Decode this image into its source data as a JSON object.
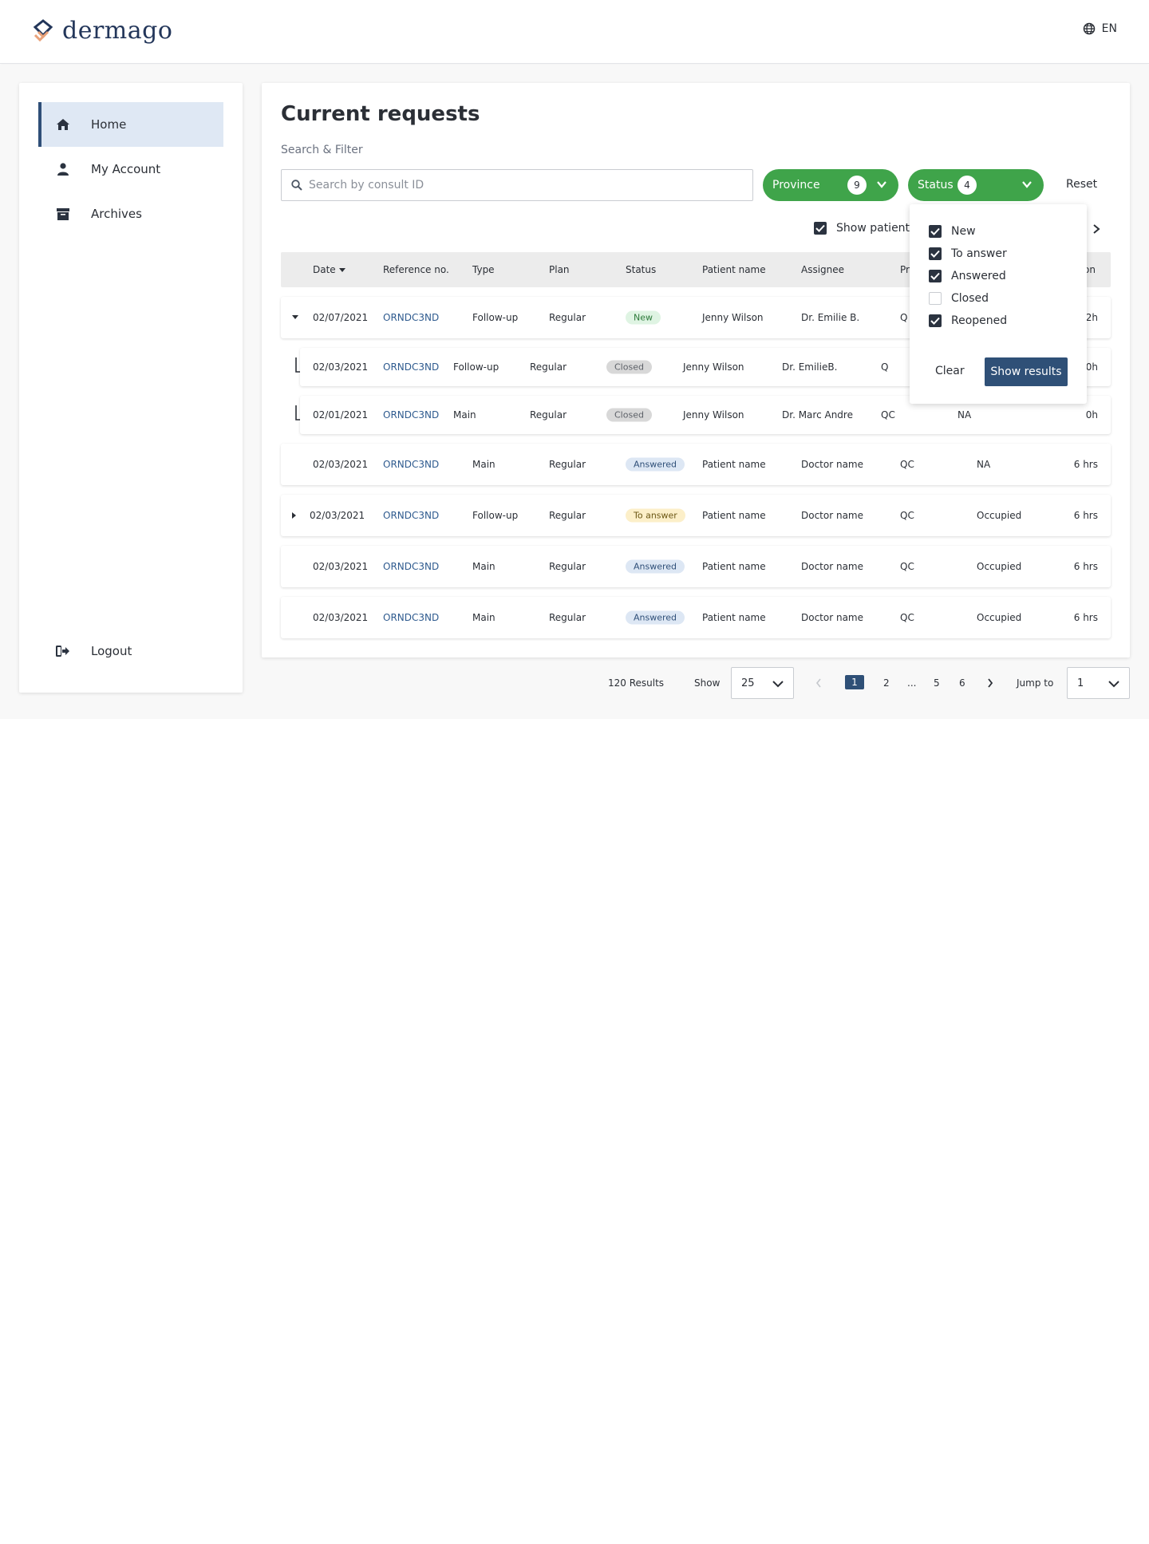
{
  "brand": {
    "name": "dermago"
  },
  "header": {
    "language": "EN"
  },
  "sidebar": {
    "items": [
      {
        "label": "Home",
        "icon": "home-icon",
        "active": true
      },
      {
        "label": "My Account",
        "icon": "user-icon"
      },
      {
        "label": "Archives",
        "icon": "archive-icon"
      }
    ],
    "logout": {
      "label": "Logout",
      "icon": "logout-icon"
    }
  },
  "main": {
    "title": "Current requests",
    "filter_label": "Search & Filter",
    "search": {
      "placeholder": "Search by consult ID",
      "value": ""
    },
    "province_filter": {
      "label": "Province",
      "count": "9"
    },
    "status_filter": {
      "label": "Status",
      "count": "4"
    },
    "reset_label": "Reset",
    "show_patients_label": "Show patients",
    "table": {
      "columns": [
        "Date",
        "Reference no.",
        "Type",
        "Plan",
        "Status",
        "Patient name",
        "Assignee",
        "Pr",
        "on"
      ],
      "rows": [
        {
          "date": "02/07/2021",
          "ref": "ORNDC3ND",
          "type": "Follow-up",
          "plan": "Regular",
          "status": "New",
          "patient": "Jenny Wilson",
          "assignee": "Dr. Emilie B.",
          "province": "Q",
          "availability": "",
          "time": "2h"
        },
        {
          "date": "02/03/2021",
          "ref": "ORNDC3ND",
          "type": "Follow-up",
          "plan": "Regular",
          "status": "Closed",
          "patient": "Jenny Wilson",
          "assignee": "Dr. EmilieB.",
          "province": "Q",
          "availability": "",
          "time": "0h"
        },
        {
          "date": "02/01/2021",
          "ref": "ORNDC3ND",
          "type": "Main",
          "plan": "Regular",
          "status": "Closed",
          "patient": "Jenny Wilson",
          "assignee": "Dr. Marc Andre",
          "province": "QC",
          "availability": "NA",
          "time": "0h"
        },
        {
          "date": "02/03/2021",
          "ref": "ORNDC3ND",
          "type": "Main",
          "plan": "Regular",
          "status": "Answered",
          "patient": "Patient name",
          "assignee": "Doctor name",
          "province": "QC",
          "availability": "NA",
          "time": "6 hrs"
        },
        {
          "date": "02/03/2021",
          "ref": "ORNDC3ND",
          "type": "Follow-up",
          "plan": "Regular",
          "status": "To answer",
          "patient": "Patient name",
          "assignee": "Doctor name",
          "province": "QC",
          "availability": "Occupied",
          "time": "6 hrs"
        },
        {
          "date": "02/03/2021",
          "ref": "ORNDC3ND",
          "type": "Main",
          "plan": "Regular",
          "status": "Answered",
          "patient": "Patient name",
          "assignee": "Doctor name",
          "province": "QC",
          "availability": "Occupied",
          "time": "6 hrs"
        },
        {
          "date": "02/03/2021",
          "ref": "ORNDC3ND",
          "type": "Main",
          "plan": "Regular",
          "status": "Answered",
          "patient": "Patient name",
          "assignee": "Doctor name",
          "province": "QC",
          "availability": "Occupied",
          "time": "6 hrs"
        }
      ]
    }
  },
  "status_dropdown": {
    "options": [
      {
        "label": "New",
        "checked": true
      },
      {
        "label": "To answer",
        "checked": true
      },
      {
        "label": "Answered",
        "checked": true
      },
      {
        "label": "Closed",
        "checked": false
      },
      {
        "label": "Reopened",
        "checked": true
      }
    ],
    "clear_label": "Clear",
    "show_results_label": "Show results"
  },
  "pagination": {
    "results": "120 Results",
    "show_label": "Show",
    "page_size": "25",
    "pages": [
      "1",
      "2",
      "...",
      "5",
      "6"
    ],
    "current_page": "1",
    "jump_label": "Jump to",
    "jump_value": "1"
  },
  "colors": {
    "primary": "#2f5077",
    "green": "#3fa44a",
    "nav_active": "#dfe8f4",
    "logo_accent": "#e9a27a"
  }
}
